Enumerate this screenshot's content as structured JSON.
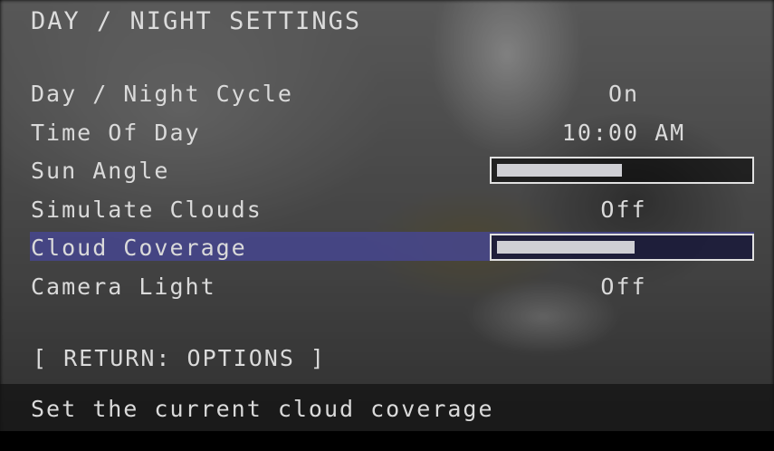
{
  "screen": {
    "title": "DAY / NIGHT SETTINGS"
  },
  "menu": {
    "items": [
      {
        "label": "Day / Night Cycle",
        "type": "value",
        "value": "On",
        "selected": false
      },
      {
        "label": "Time Of Day",
        "type": "value",
        "value": "10:00 AM",
        "selected": false
      },
      {
        "label": "Sun Angle",
        "type": "slider",
        "level": 0.5,
        "selected": false
      },
      {
        "label": "Simulate Clouds",
        "type": "value",
        "value": "Off",
        "selected": false
      },
      {
        "label": "Cloud Coverage",
        "type": "slider",
        "level": 0.55,
        "selected": true
      },
      {
        "label": "Camera Light",
        "type": "value",
        "value": "Off",
        "selected": false
      }
    ],
    "return_label": "[ RETURN: OPTIONS ]"
  },
  "help": {
    "text": "Set the current cloud coverage"
  },
  "colors": {
    "highlight": "#46469a",
    "text": "#dadada",
    "slider_fill": "#cfcfd4"
  }
}
